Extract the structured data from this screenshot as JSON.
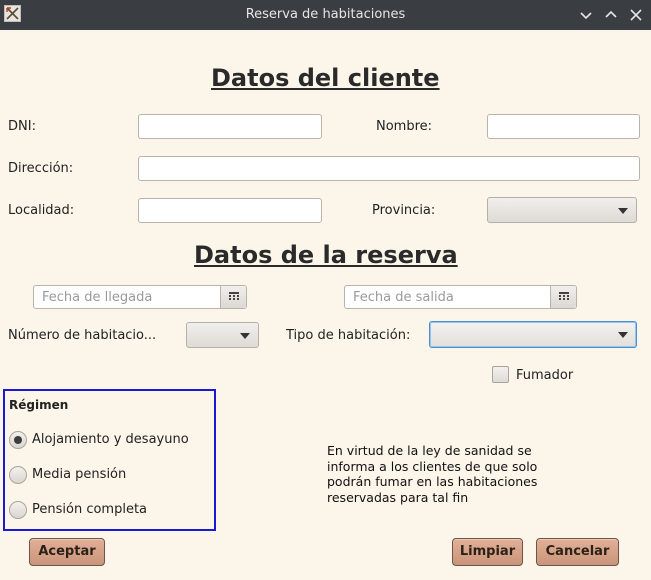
{
  "window": {
    "title": "Reserva de habitaciones"
  },
  "client": {
    "heading": "Datos del cliente",
    "dni_label": "DNI:",
    "dni_value": "",
    "nombre_label": "Nombre:",
    "nombre_value": "",
    "direccion_label": "Dirección:",
    "direccion_value": "",
    "localidad_label": "Localidad:",
    "localidad_value": "",
    "provincia_label": "Provincia:",
    "provincia_selected": ""
  },
  "reserva": {
    "heading": "Datos de la reserva",
    "llegada_placeholder": "Fecha de llegada",
    "salida_placeholder": "Fecha de salida",
    "numero_label": "Número de habitacio...",
    "numero_selected": "",
    "tipo_label": "Tipo de habitación:",
    "tipo_selected": "",
    "fumador_label": "Fumador",
    "fumador_checked": false
  },
  "regimen": {
    "title": "Régimen",
    "options": [
      {
        "label": "Alojamiento y desayuno",
        "selected": true
      },
      {
        "label": "Media pensión",
        "selected": false
      },
      {
        "label": "Pensión completa",
        "selected": false
      }
    ]
  },
  "notice": {
    "text": "En virtud de la ley de sanidad se informa a los clientes de que solo podrán fumar en las habitaciones reservadas para tal fin"
  },
  "buttons": {
    "aceptar": "Aceptar",
    "limpiar": "Limpiar",
    "cancelar": "Cancelar"
  },
  "colors": {
    "window_bg": "#fbf5ea",
    "titlebar_bg": "#3a3d41",
    "button_bg": "#d6a389",
    "group_border": "#1a1ad6"
  }
}
